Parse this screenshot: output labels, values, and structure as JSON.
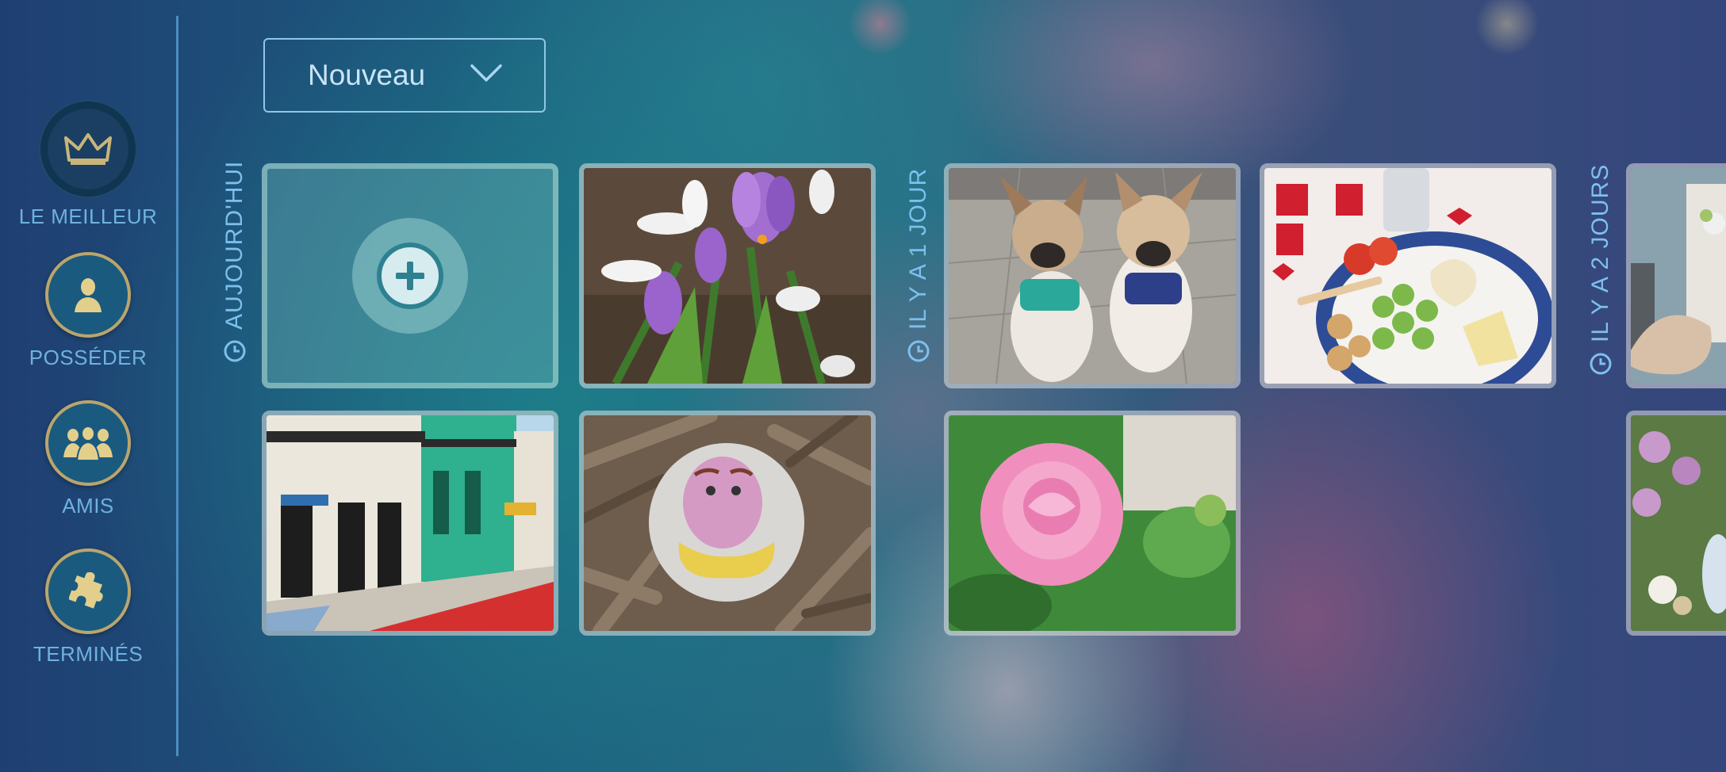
{
  "sidebar": {
    "items": [
      {
        "label": "LE MEILLEUR",
        "icon": "crown-icon",
        "active": true
      },
      {
        "label": "POSSÉDER",
        "icon": "person-icon",
        "active": false
      },
      {
        "label": "AMIS",
        "icon": "group-icon",
        "active": false
      },
      {
        "label": "TERMINÉS",
        "icon": "puzzle-icon",
        "active": false
      }
    ]
  },
  "sort_dropdown": {
    "selected": "Nouveau"
  },
  "sections": [
    {
      "label": "AUJOURD'HUI",
      "icon": "clock-icon"
    },
    {
      "label": "IL Y A 1 JOUR",
      "icon": "clock-icon"
    },
    {
      "label": "IL Y A 2 JOURS",
      "icon": "clock-icon"
    }
  ],
  "tiles": [
    {
      "kind": "add",
      "icon": "plus-icon",
      "section": "AUJOURD'HUI"
    },
    {
      "kind": "photo",
      "subject": "crocus and snowdrop flowers",
      "section": "AUJOURD'HUI"
    },
    {
      "kind": "photo",
      "subject": "colorful street buildings",
      "section": "AUJOURD'HUI"
    },
    {
      "kind": "photo",
      "subject": "painted rock on wood",
      "section": "AUJOURD'HUI"
    },
    {
      "kind": "photo",
      "subject": "two french bulldogs",
      "section": "IL Y A 1 JOUR"
    },
    {
      "kind": "photo",
      "subject": "pink rose",
      "section": "IL Y A 1 JOUR"
    },
    {
      "kind": "photo",
      "subject": "valentine snack plate",
      "section": "IL Y A 1 JOUR"
    },
    {
      "kind": "photo",
      "subject": "room with flowers and shell",
      "section": "IL Y A 2 JOURS"
    },
    {
      "kind": "photo",
      "subject": "flowers and doll",
      "section": "IL Y A 2 JOURS"
    }
  ],
  "colors": {
    "accent_gold": "#b9a66c",
    "label_blue": "#6fb2df",
    "divider": "#4a8fc0"
  }
}
